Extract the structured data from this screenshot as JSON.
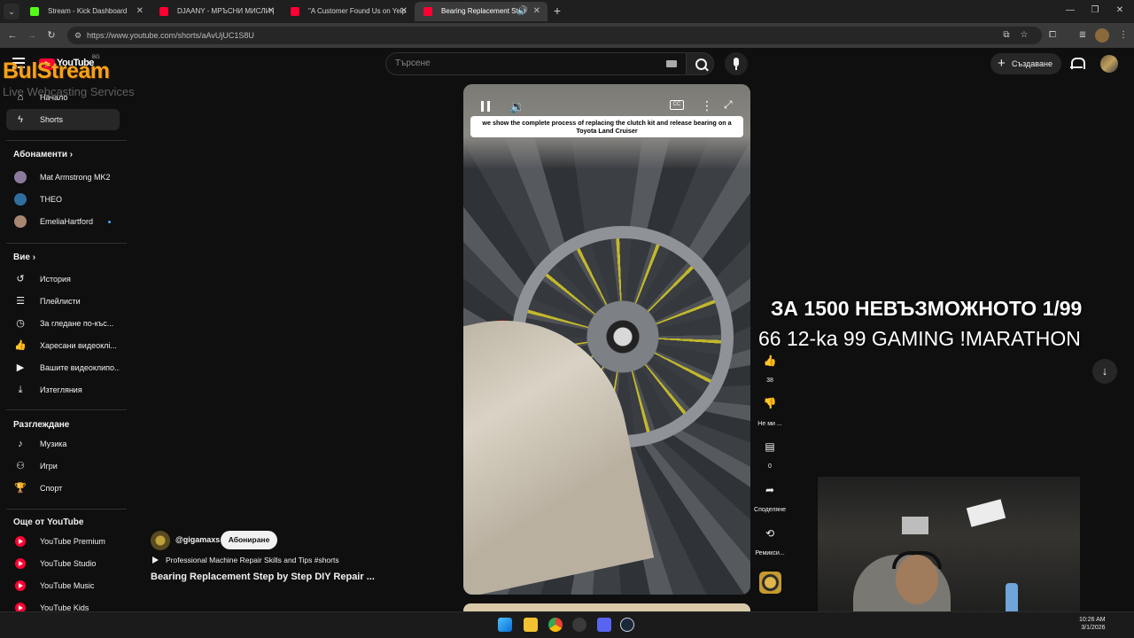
{
  "browser": {
    "tabs": [
      {
        "label": "Stream - Kick Dashboard",
        "favicon_color": "#53fc18"
      },
      {
        "label": "DJAANY - МРЪСНИ МИСЛИ |",
        "favicon_color": "#ff0033"
      },
      {
        "label": "\"A Customer Found Us on Yelp",
        "favicon_color": "#ff0033"
      },
      {
        "label": "Bearing Replacement Step",
        "favicon_color": "#ff0033"
      }
    ],
    "url": "https://www.youtube.com/shorts/aAvUjUC1S8U"
  },
  "watermark": {
    "brand": "BulStream",
    "tagline": "Live Webcasting Services",
    "color": "#f5a21b"
  },
  "youtube": {
    "logo_text": "YouTube",
    "region": "BG",
    "search_placeholder": "Търсене",
    "create_label": "Създаване"
  },
  "sidebar": {
    "main": [
      {
        "label": "Начало",
        "icon": "home-icon"
      },
      {
        "label": "Shorts",
        "icon": "shorts-icon"
      }
    ],
    "subscriptions_heading": "Абонаменти",
    "subscriptions": [
      {
        "label": "Mat Armstrong MK2"
      },
      {
        "label": "THEO"
      },
      {
        "label": "EmeliaHartford"
      }
    ],
    "you_heading": "Вие",
    "you": [
      {
        "label": "История",
        "icon": "history-icon"
      },
      {
        "label": "Плейлисти",
        "icon": "playlists-icon"
      },
      {
        "label": "За гледане по-къс...",
        "icon": "watch-later-icon"
      },
      {
        "label": "Харесани видеоклі...",
        "icon": "liked-icon"
      },
      {
        "label": "Вашите видеоклипо...",
        "icon": "your-videos-icon"
      },
      {
        "label": "Изтегляния",
        "icon": "downloads-icon"
      }
    ],
    "explore_heading": "Разглеждане",
    "explore": [
      {
        "label": "Музика",
        "icon": "music-icon"
      },
      {
        "label": "Игри",
        "icon": "gaming-icon"
      },
      {
        "label": "Спорт",
        "icon": "sports-icon"
      }
    ],
    "more_heading": "Още от YouTube",
    "more": [
      {
        "label": "YouTube Premium"
      },
      {
        "label": "YouTube Studio"
      },
      {
        "label": "YouTube Music"
      },
      {
        "label": "YouTube Kids"
      }
    ]
  },
  "short": {
    "caption": "we show the complete process of replacing the clutch kit and release bearing on a Toyota Land Cruiser",
    "channel": "@gigamaxs",
    "subscribe_label": "Абониране",
    "song": "Professional Machine Repair Skills and Tips #shorts",
    "title": "Bearing Replacement Step by Step DIY Repair ...",
    "likes": "38",
    "dislike_label": "Не ми ...",
    "comments": "0",
    "share_label": "Споделяне",
    "remix_label": "Ремикси..."
  },
  "overlay": {
    "line1": "ЗА 1500 НЕВЪЗМОЖНОТО 1/99",
    "line2": "66 12-ka 99 GAMING !MARATHON"
  },
  "taskbar": {
    "time": "10:26 AM",
    "date": "3/1/2026"
  }
}
